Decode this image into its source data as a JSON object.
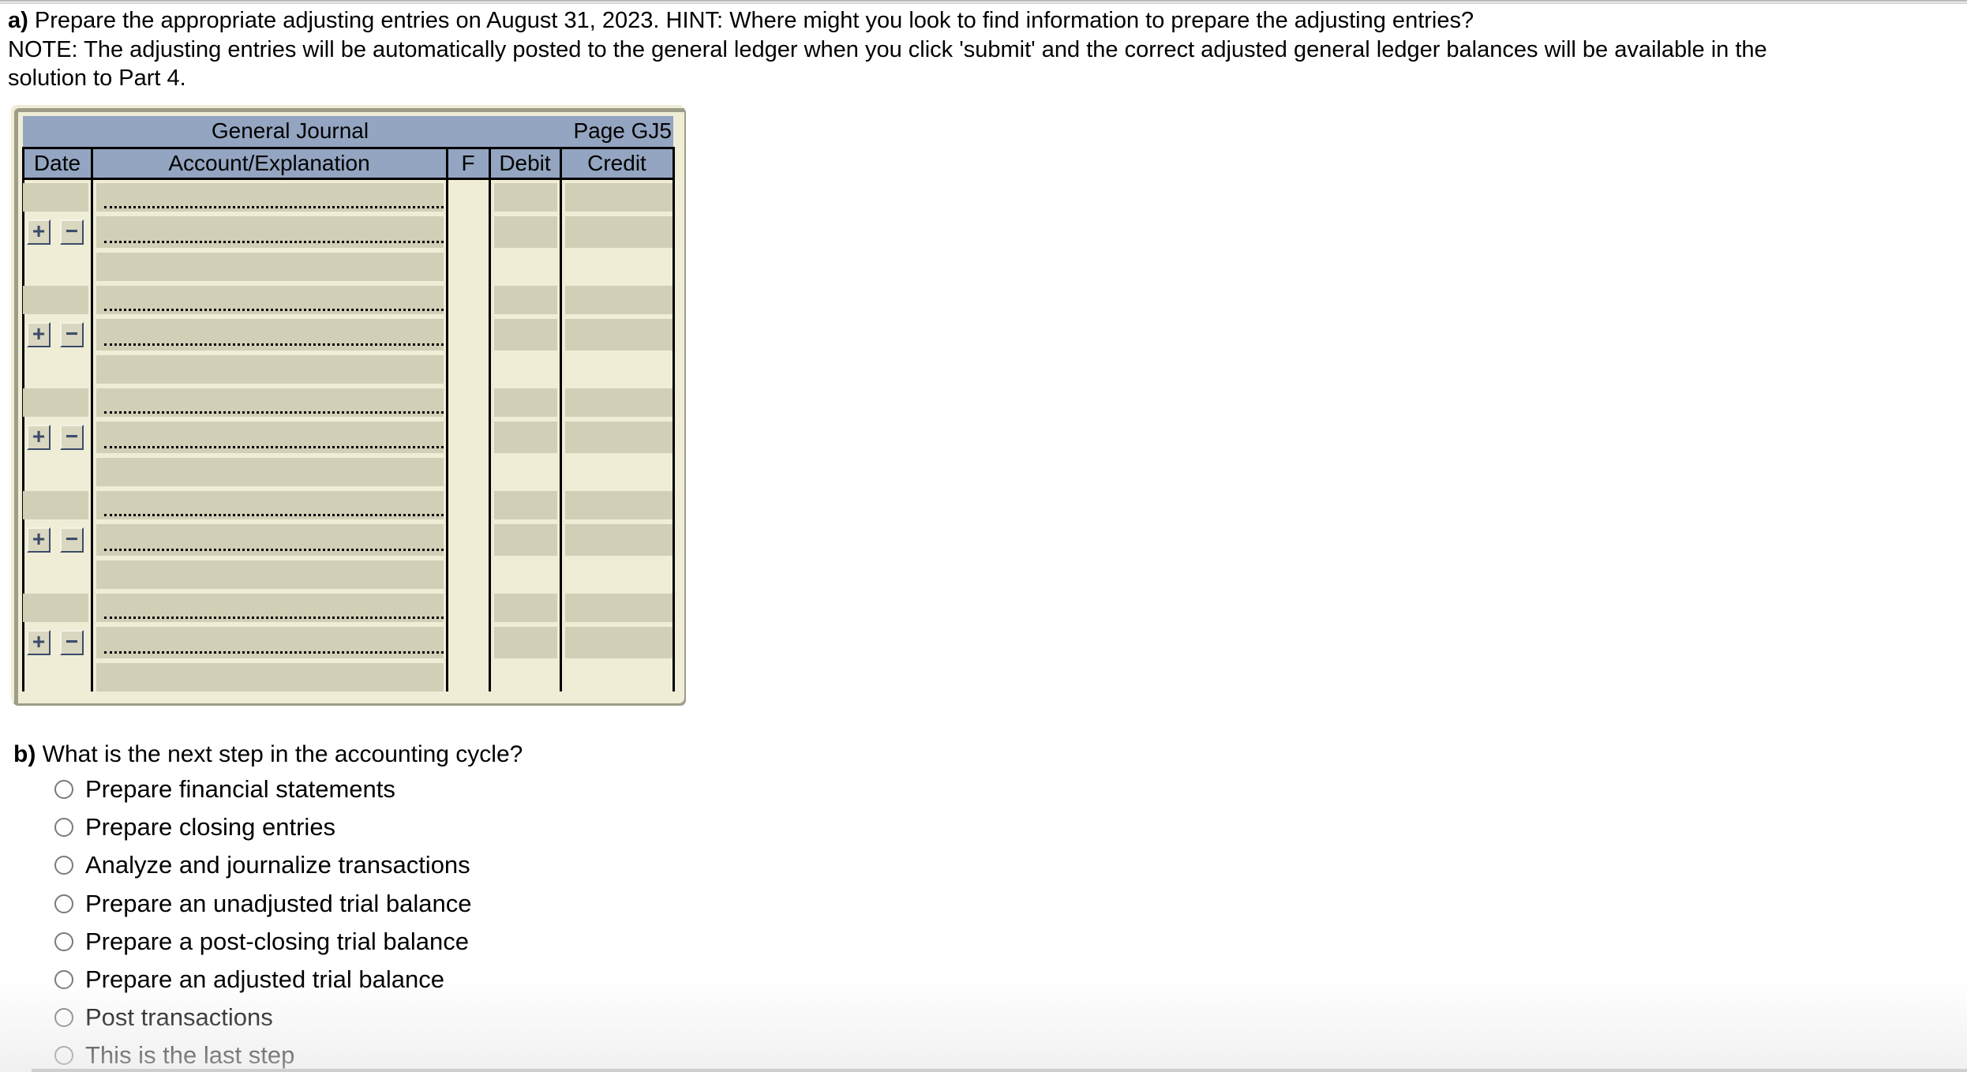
{
  "part_a": {
    "label": "a)",
    "lines": [
      "Prepare the appropriate adjusting entries on August 31, 2023. HINT: Where might you look to find information to prepare the adjusting entries?",
      "NOTE: The adjusting entries will be automatically posted to the general ledger when you click 'submit' and the correct adjusted general ledger balances will be available in the",
      "solution to Part 4."
    ]
  },
  "journal": {
    "title": "General Journal",
    "page": "Page GJ5",
    "columns": {
      "date": "Date",
      "account": "Account/Explanation",
      "f": "F",
      "debit": "Debit",
      "credit": "Credit"
    },
    "entries": [
      {
        "date": "",
        "lines": [
          {
            "account": "",
            "debit": "",
            "credit": ""
          },
          {
            "account": "",
            "debit": "",
            "credit": ""
          }
        ],
        "explanation": ""
      },
      {
        "date": "",
        "lines": [
          {
            "account": "",
            "debit": "",
            "credit": ""
          },
          {
            "account": "",
            "debit": "",
            "credit": ""
          }
        ],
        "explanation": ""
      },
      {
        "date": "",
        "lines": [
          {
            "account": "",
            "debit": "",
            "credit": ""
          },
          {
            "account": "",
            "debit": "",
            "credit": ""
          }
        ],
        "explanation": ""
      },
      {
        "date": "",
        "lines": [
          {
            "account": "",
            "debit": "",
            "credit": ""
          },
          {
            "account": "",
            "debit": "",
            "credit": ""
          }
        ],
        "explanation": ""
      },
      {
        "date": "",
        "lines": [
          {
            "account": "",
            "debit": "",
            "credit": ""
          },
          {
            "account": "",
            "debit": "",
            "credit": ""
          }
        ],
        "explanation": ""
      }
    ],
    "add_row_label": "+",
    "remove_row_label": "−",
    "colors": {
      "header": "#94a5c1",
      "panel": "#efedd6",
      "field": "#d1cfb6",
      "button_ink": "#3c4b69"
    }
  },
  "part_b": {
    "label": "b)",
    "question": "What is the next step in the accounting cycle?",
    "options": [
      {
        "label": "Prepare financial statements",
        "selected": false
      },
      {
        "label": "Prepare closing entries",
        "selected": false
      },
      {
        "label": "Analyze and journalize transactions",
        "selected": false
      },
      {
        "label": "Prepare an unadjusted trial balance",
        "selected": false
      },
      {
        "label": "Prepare a post-closing trial balance",
        "selected": false
      },
      {
        "label": "Prepare an adjusted trial balance",
        "selected": false
      },
      {
        "label": "Post transactions",
        "selected": false
      },
      {
        "label": "This is the last step",
        "selected": false
      }
    ]
  }
}
